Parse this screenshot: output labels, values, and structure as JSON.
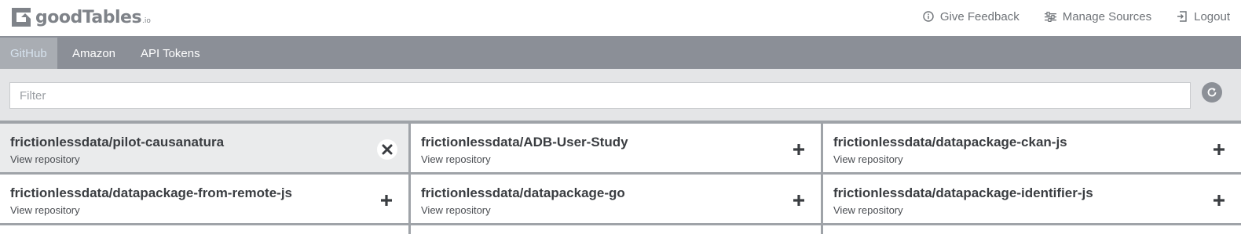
{
  "brand": {
    "name": "goodTables",
    "suffix": ".io"
  },
  "nav": {
    "feedback": "Give Feedback",
    "manage_sources": "Manage Sources",
    "logout": "Logout"
  },
  "tabs": [
    {
      "label": "GitHub",
      "active": true
    },
    {
      "label": "Amazon",
      "active": false
    },
    {
      "label": "API Tokens",
      "active": false
    }
  ],
  "filter": {
    "placeholder": "Filter",
    "value": ""
  },
  "repos": [
    {
      "name": "frictionlessdata/pilot-causanatura",
      "link": "View repository",
      "active": true,
      "action": "remove"
    },
    {
      "name": "frictionlessdata/ADB-User-Study",
      "link": "View repository",
      "active": false,
      "action": "add"
    },
    {
      "name": "frictionlessdata/datapackage-ckan-js",
      "link": "View repository",
      "active": false,
      "action": "add"
    },
    {
      "name": "frictionlessdata/datapackage-from-remote-js",
      "link": "View repository",
      "active": false,
      "action": "add"
    },
    {
      "name": "frictionlessdata/datapackage-go",
      "link": "View repository",
      "active": false,
      "action": "add"
    },
    {
      "name": "frictionlessdata/datapackage-identifier-js",
      "link": "View repository",
      "active": false,
      "action": "add"
    }
  ],
  "colors": {
    "tabbar": "#8b8f97",
    "active_tab": "#a9adb3",
    "filterbar": "#e4e5e7",
    "card_divider": "#9fa3a8"
  }
}
